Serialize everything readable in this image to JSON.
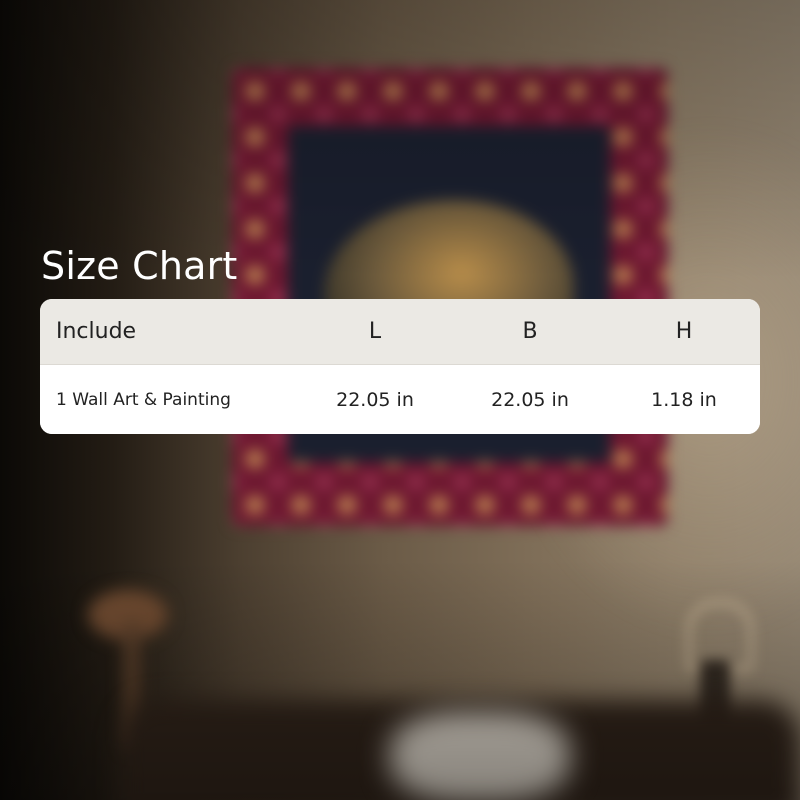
{
  "title": "Size Chart",
  "table": {
    "columns": [
      "Include",
      "L",
      "B",
      "H"
    ],
    "rows": [
      [
        "1 Wall Art & Painting",
        "22.05 in",
        "22.05 in",
        "1.18 in"
      ]
    ]
  },
  "colors": {
    "title_text": "#ffffff",
    "header_background": "#ebe9e4",
    "body_background": "#ffffff",
    "cell_text": "#222222"
  }
}
